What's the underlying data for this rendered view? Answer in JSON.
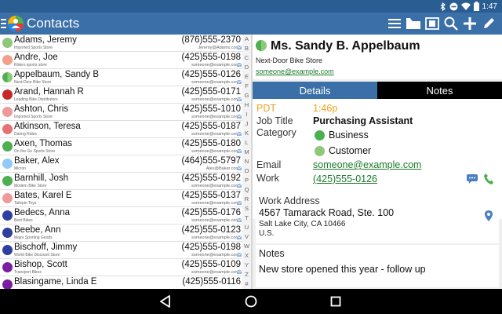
{
  "status_bar": {
    "time": "1:47",
    "icons": [
      "bluetooth-icon",
      "do-not-disturb-icon",
      "wifi-icon",
      "battery-icon"
    ]
  },
  "app_bar": {
    "title": "Contacts",
    "actions": [
      "sort-list-icon",
      "folder-icon",
      "copy-icon",
      "search-icon",
      "add-icon",
      "edit-icon",
      "overflow-menu-icon"
    ],
    "color": "#3a6fa8"
  },
  "contacts": [
    {
      "name": "Adams, Jeremy",
      "company": "Imported Sports Store",
      "phone": "(876)555-2370",
      "email": "Jeremy@Adams.com",
      "color": "#8ec97a",
      "half": false
    },
    {
      "name": "Andre, Joe",
      "company": "Riders sports store",
      "phone": "(425)555-0198",
      "email": "someone@example.com",
      "color": "#f2a08a",
      "half": false
    },
    {
      "name": "Appelbaum, Sandy B",
      "company": "Next-Door Bike Store",
      "phone": "(425)555-0126",
      "email": "someone@example.com",
      "color": "#4caf50",
      "half": true
    },
    {
      "name": "Arand, Hannah R",
      "company": "Leading Bike Distributors",
      "phone": "(425)555-0171",
      "email": "someone@example.com",
      "color": "#c62828",
      "half": false
    },
    {
      "name": "Ashton, Chris",
      "company": "Imported Sports Store",
      "phone": "(425)555-1010",
      "email": "someone@example.com",
      "color": "#ef9a9a",
      "half": false
    },
    {
      "name": "Atkinson, Teresa",
      "company": "Daring Rides",
      "phone": "(425)555-0187",
      "email": "someone@example.com",
      "color": "#e57373",
      "half": false
    },
    {
      "name": "Axen, Thomas",
      "company": "On the Go Sports Store",
      "phone": "(425)555-0180",
      "email": "someone@example.com",
      "color": "#4caf50",
      "half": false
    },
    {
      "name": "Baker, Alex",
      "company": "Micron",
      "phone": "(464)555-5797",
      "email": "Alex@Baker.com",
      "color": "#90caf9",
      "half": false
    },
    {
      "name": "Barnhill, Josh",
      "company": "Modern Bike Store",
      "phone": "(425)555-0192",
      "email": "someone@example.com",
      "color": "#4caf50",
      "half": false
    },
    {
      "name": "Bates, Karel E",
      "company": "Tailspin Toys",
      "phone": "(425)555-0137",
      "email": "someone@example.com",
      "color": "#ef9a9a",
      "half": false
    },
    {
      "name": "Bedecs, Anna",
      "company": "Best Bikes",
      "phone": "(425)555-0176",
      "email": "someone@example.com",
      "color": "#303f9f",
      "half": false
    },
    {
      "name": "Beebe, Ann",
      "company": "Major Sporting Goods",
      "phone": "(425)555-0123",
      "email": "someone@example.com",
      "color": "#303f9f",
      "half": false
    },
    {
      "name": "Bischoff, Jimmy",
      "company": "World Bike Discount Store",
      "phone": "(425)555-0198",
      "email": "someone@example.com",
      "color": "#303f9f",
      "half": false
    },
    {
      "name": "Bishop, Scott",
      "company": "Transport Bikes",
      "phone": "(425)555-0109",
      "email": "someone@example.com",
      "color": "#7b1fa2",
      "half": false
    },
    {
      "name": "Blasingame, Linda E",
      "company": "",
      "phone": "(425)555-0116",
      "email": "",
      "color": "#7b1fa2",
      "half": false
    }
  ],
  "alpha_index": [
    "A",
    "B",
    "C",
    "D",
    "E",
    "F",
    "G",
    "H",
    "I",
    "J",
    "K",
    "L",
    "M",
    "N",
    "O",
    "P",
    "Q",
    "R",
    "S",
    "T",
    "U",
    "V",
    "W",
    "X",
    "Y",
    "Z",
    "#"
  ],
  "detail": {
    "name": "Ms. Sandy B. Appelbaum",
    "company": "Next-Door Bike Store",
    "email": "someone@example.com",
    "tabs": {
      "details": "Details",
      "notes": "Notes"
    },
    "fields": {
      "pdt_label": "PDT",
      "pdt_value": "1:46p",
      "job_title_label": "Job Title",
      "job_title_value": "Purchasing Assistant",
      "category_label": "Category",
      "category_1": "Business",
      "category_2": "Customer",
      "email_label": "Email",
      "email_value": "someone@example.com",
      "work_label": "Work",
      "work_value": "(425)555-0126"
    },
    "address": {
      "title": "Work Address",
      "line1": "4567 Tamarack Road, Ste. 100",
      "line2": "Salt Lake City, CA 10466",
      "line3": "U.S."
    },
    "notes": {
      "title": "Notes",
      "text": "New store opened this year - follow up"
    }
  },
  "nav": {
    "icons": [
      "back-icon",
      "home-icon",
      "recents-icon"
    ]
  },
  "colors": {
    "accent": "#3a6fa8",
    "link": "#1a7a2a",
    "time_accent": "#f0a020",
    "business": "#4caf50",
    "customer": "#8ec97a"
  }
}
